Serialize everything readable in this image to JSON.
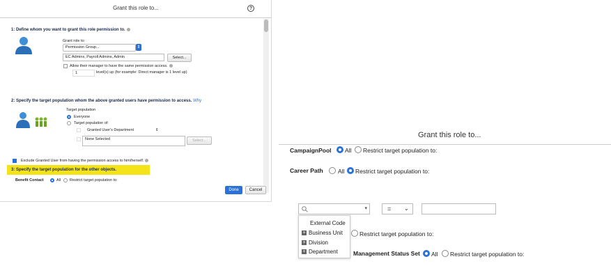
{
  "left": {
    "title": "Grant this role to...",
    "help": "?",
    "section1": "1: Define whom you want to grant this role permission to.",
    "grant_role_to_label": "Grant role to:",
    "grant_role_select": "Permission Group...",
    "groups_value": "EC Admins, Payroll Admins, Admin",
    "select_button": "Select...",
    "allow_manager_label": "Allow their manager to have the same permission access.",
    "levels_value": "1",
    "levels_label": "level(s) up (for example: Direct manager is 1 level up)",
    "section2": "2: Specify the target population whom the above granted users have permission to access.",
    "why_link": "Why",
    "target_population_label": "Target population",
    "everyone_label": "Everyone",
    "target_population_of_label": "Target population of:",
    "granted_dept_select": "Granted User's Department",
    "none_selected": "None Selected",
    "select_button_2": "Select...",
    "exclude_label": "Exclude Granted User from having the permission access to him/herself.",
    "section3": "3: Specify the target population for the other objects.",
    "benefit_contact_label": "Benefit Contact",
    "all_label": "All",
    "restrict_label": "Restrict target population to:",
    "done_button": "Done",
    "cancel_button": "Cancel"
  },
  "right": {
    "title": "Grant this role to...",
    "campaign_pool_label": "CampaignPool",
    "all_1": "All",
    "restrict_1": "Restrict target population to:",
    "career_path_label": "Career Path",
    "all_2": "All",
    "restrict_2": "Restrict target population to:",
    "operator_value": "=",
    "dropdown_items": [
      "External Code",
      "Business Unit",
      "Division",
      "Department"
    ],
    "restrict_3": "Restrict target population to:",
    "management_status_label": "Management Status Set",
    "all_4": "All",
    "restrict_4": "Restrict target population to:"
  },
  "colors": {
    "accent": "#2b72d8",
    "highlight": "#f5e31a"
  }
}
